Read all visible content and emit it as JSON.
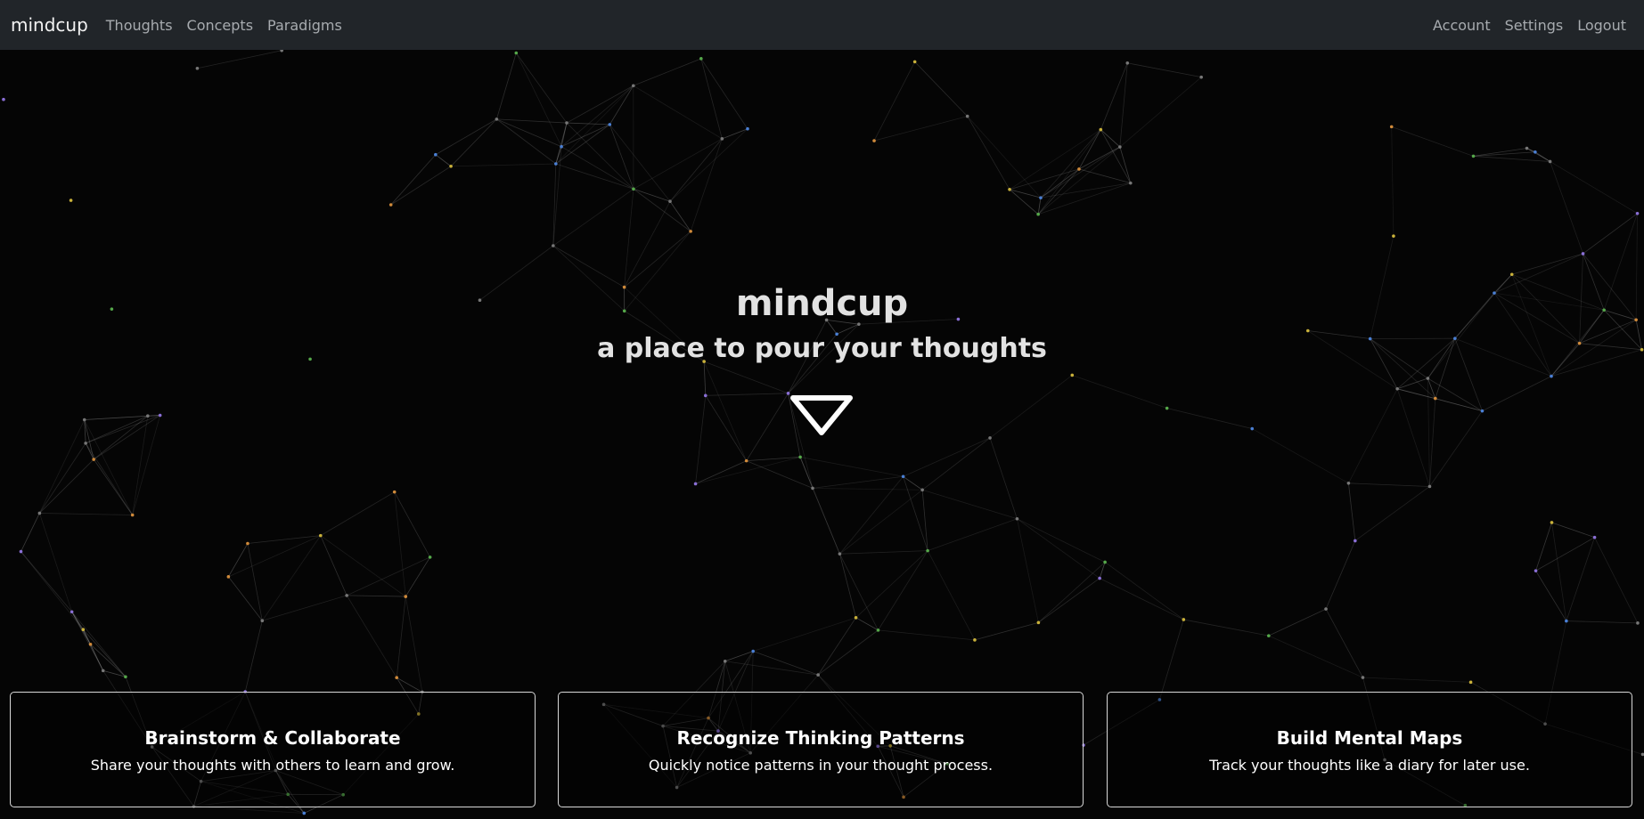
{
  "nav": {
    "brand": "mindcup",
    "links": [
      "Thoughts",
      "Concepts",
      "Paradigms"
    ],
    "right_links": [
      "Account",
      "Settings",
      "Logout"
    ]
  },
  "hero": {
    "title": "mindcup",
    "subtitle": "a place to pour your thoughts",
    "scroll_icon": "triangle-down-icon"
  },
  "cards": [
    {
      "title": "Brainstorm & Collaborate",
      "text": "Share your thoughts with others to learn and grow."
    },
    {
      "title": "Recognize Thinking Patterns",
      "text": "Quickly notice patterns in your thought process."
    },
    {
      "title": "Build Mental Maps",
      "text": "Track your thoughts like a diary for later use."
    }
  ],
  "colors": {
    "navbar": "#212529",
    "background": "#050505",
    "nav_link": "#a7abaf",
    "node_palette": [
      "#4a7fd4",
      "#c9b13a",
      "#55a84a",
      "#8a6fd6",
      "#d08a3a"
    ]
  }
}
